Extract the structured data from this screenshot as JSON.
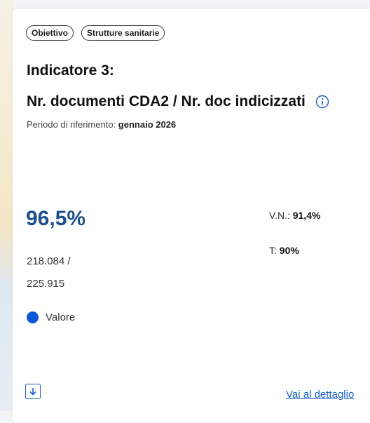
{
  "card": {
    "tags": [
      "Obiettivo",
      "Strutture sanitarie"
    ],
    "indicator_label": "Indicatore 3:",
    "metric_title": "Nr. documenti CDA2 / Nr. doc indicizzati",
    "period_label": "Periodo di riferimento:",
    "period_value": "gennaio 2026",
    "value": "96,5%",
    "fraction_numerator": "218.084 /",
    "fraction_denominator": "225.915",
    "vn_label": "V.N.:",
    "vn_value": "91,4%",
    "target_label": "T:",
    "target_value": "90%",
    "legend_label": "Valore",
    "detail_link": "Vai al dettaglio"
  },
  "colors": {
    "value_text": "#1d4f8c",
    "legend_dot": "#0a58d8",
    "link": "#1a5fc4"
  },
  "icons": {
    "info": "info-icon",
    "download": "download-icon"
  }
}
